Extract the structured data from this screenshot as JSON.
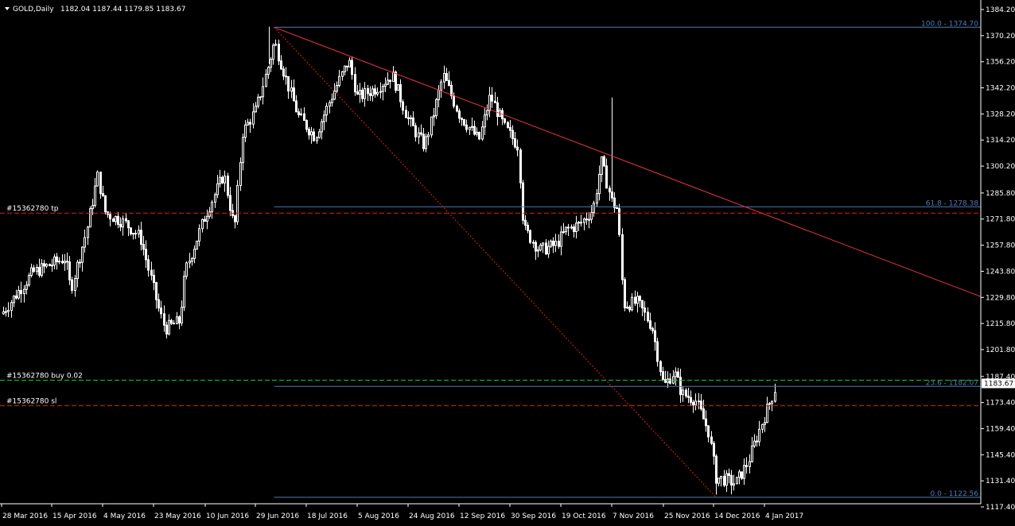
{
  "header": {
    "symbol": "GOLD,Daily",
    "ohlc": "1182.04 1187.44 1179.85 1183.67"
  },
  "colors": {
    "background": "#000000",
    "axis": "#ffffff",
    "grid": "#7d7d7d",
    "candle": "#ffffff",
    "trendline": "#e8334a",
    "fibonacci": "#4f7bb6",
    "entry_line": "#1ec81e",
    "tp_sl_line": "#e01d1d",
    "price_badge": "#ffffff"
  },
  "chart_data": {
    "type": "candlestick",
    "symbol": "GOLD",
    "timeframe": "Daily",
    "current_price": 1183.67,
    "price_badge": "1183.67",
    "ylim": [
      1117.4,
      1384.2
    ],
    "y_ticks": [
      "1384.20",
      "1370.20",
      "1356.20",
      "1342.20",
      "1328.20",
      "1314.20",
      "1300.20",
      "1285.80",
      "1271.80",
      "1257.80",
      "1243.80",
      "1229.80",
      "1215.80",
      "1201.80",
      "1187.40",
      "1173.40",
      "1159.40",
      "1145.40",
      "1131.40",
      "1117.40"
    ],
    "x_ticks": [
      "28 Mar 2016",
      "15 Apr 2016",
      "4 May 2016",
      "23 May 2016",
      "10 Jun 2016",
      "29 Jun 2016",
      "18 Jul 2016",
      "5 Aug 2016",
      "24 Aug 2016",
      "12 Sep 2016",
      "30 Sep 2016",
      "19 Oct 2016",
      "7 Nov 2016",
      "25 Nov 2016",
      "14 Dec 2016",
      "4 Jan 2017"
    ],
    "grid": true,
    "close_path": [
      [
        "28 Mar 2016",
        1221
      ],
      [
        "8 Apr 2016",
        1243
      ],
      [
        "20 Apr 2016",
        1251
      ],
      [
        "22 Apr 2016",
        1234
      ],
      [
        "28 Apr 2016",
        1266
      ],
      [
        "2 May 2016",
        1295
      ],
      [
        "5 May 2016",
        1275
      ],
      [
        "12 May 2016",
        1270
      ],
      [
        "18 May 2016",
        1262
      ],
      [
        "25 May 2016",
        1222
      ],
      [
        "27 May 2016",
        1213
      ],
      [
        "1 Jun 2016",
        1217
      ],
      [
        "3 Jun 2016",
        1244
      ],
      [
        "10 Jun 2016",
        1274
      ],
      [
        "17 Jun 2016",
        1296
      ],
      [
        "21 Jun 2016",
        1266
      ],
      [
        "24 Jun 2016",
        1318
      ],
      [
        "29 Jun 2016",
        1330
      ],
      [
        "4 Jul 2016",
        1355
      ],
      [
        "6 Jul 2016",
        1367
      ],
      [
        "11 Jul 2016",
        1344
      ],
      [
        "15 Jul 2016",
        1327
      ],
      [
        "21 Jul 2016",
        1316
      ],
      [
        "27 Jul 2016",
        1338
      ],
      [
        "2 Aug 2016",
        1357
      ],
      [
        "5 Aug 2016",
        1337
      ],
      [
        "12 Aug 2016",
        1342
      ],
      [
        "18 Aug 2016",
        1349
      ],
      [
        "24 Aug 2016",
        1325
      ],
      [
        "30 Aug 2016",
        1311
      ],
      [
        "2 Sep 2016",
        1326
      ],
      [
        "6 Sep 2016",
        1349
      ],
      [
        "12 Sep 2016",
        1328
      ],
      [
        "19 Sep 2016",
        1314
      ],
      [
        "23 Sep 2016",
        1338
      ],
      [
        "28 Sep 2016",
        1321
      ],
      [
        "3 Oct 2016",
        1311
      ],
      [
        "5 Oct 2016",
        1267
      ],
      [
        "11 Oct 2016",
        1255
      ],
      [
        "17 Oct 2016",
        1258
      ],
      [
        "21 Oct 2016",
        1266
      ],
      [
        "26 Oct 2016",
        1269
      ],
      [
        "31 Oct 2016",
        1277
      ],
      [
        "3 Nov 2016",
        1303
      ],
      [
        "7 Nov 2016",
        1281
      ],
      [
        "9 Nov 2016",
        1277
      ],
      [
        "11 Nov 2016",
        1226
      ],
      [
        "16 Nov 2016",
        1227
      ],
      [
        "21 Nov 2016",
        1214
      ],
      [
        "25 Nov 2016",
        1182
      ],
      [
        "29 Nov 2016",
        1190
      ],
      [
        "2 Dec 2016",
        1178
      ],
      [
        "7 Dec 2016",
        1175
      ],
      [
        "12 Dec 2016",
        1158
      ],
      [
        "15 Dec 2016",
        1133
      ],
      [
        "19 Dec 2016",
        1132
      ],
      [
        "23 Dec 2016",
        1130
      ],
      [
        "28 Dec 2016",
        1141
      ],
      [
        "3 Jan 2017",
        1163
      ],
      [
        "6 Jan 2017",
        1173
      ],
      [
        "9 Jan 2017",
        1183.67
      ]
    ],
    "spikes": [
      {
        "x": "4 Jul 2016",
        "high": 1375
      },
      {
        "x": "7 Nov 2016",
        "high": 1337
      },
      {
        "x": "15 Dec 2016",
        "low": 1124
      }
    ],
    "trendline": {
      "from": {
        "x": "6 Jul 2016",
        "y": 1374.7
      },
      "to": {
        "x": "18 Jan 2017",
        "y": 1267.5
      }
    },
    "dotted_line": {
      "from": {
        "x": "6 Jul 2016",
        "y": 1374.7
      },
      "to": {
        "x": "15 Dec 2016",
        "y": 1122.56
      }
    },
    "fibonacci": {
      "from": "6 Jul 2016",
      "levels": [
        {
          "label": "100.0 - 1374.70",
          "price": 1374.7
        },
        {
          "label": "61.8 - 1278.38",
          "price": 1278.38
        },
        {
          "label": "23.6 - 1182.07",
          "price": 1182.07
        },
        {
          "label": "0.0 - 1122.56",
          "price": 1122.56
        }
      ]
    },
    "orders": [
      {
        "label": "#15362780 tp",
        "price": 1275.0,
        "kind": "tp"
      },
      {
        "label": "#15362780 buy 0.02",
        "price": 1185.4,
        "kind": "entry"
      },
      {
        "label": "#15362780 sl",
        "price": 1171.7,
        "kind": "sl"
      }
    ]
  }
}
